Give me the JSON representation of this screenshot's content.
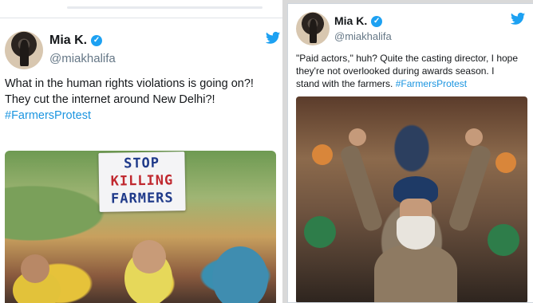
{
  "tweets": [
    {
      "name": "Mia K.",
      "handle": "@miakhalifa",
      "text_lines": [
        "What in the human rights violations is going on?!",
        "They cut the internet around New Delhi?!"
      ],
      "hashtag": "#FarmersProtest",
      "image": {
        "sign_lines": [
          "STOP",
          "KILLING",
          "FARMERS"
        ]
      }
    },
    {
      "name": "Mia K.",
      "handle": "@miakhalifa",
      "text_lines": [
        "\"Paid actors,\" huh? Quite the casting director, I hope",
        "they're not overlooked during awards season. I",
        "stand with the farmers."
      ],
      "hashtag": "#FarmersProtest"
    }
  ],
  "icons": {
    "verified": "verified-badge-icon",
    "bird": "twitter-bird-icon"
  },
  "colors": {
    "link": "#1b95e0",
    "verified": "#1da1f2",
    "text": "#14171a",
    "muted": "#657786"
  }
}
